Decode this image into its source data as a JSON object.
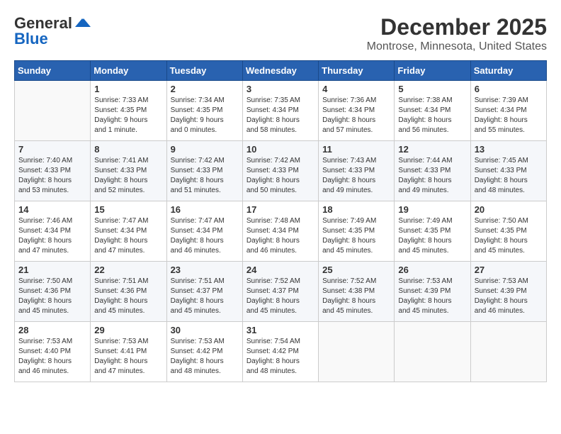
{
  "header": {
    "logo_line1": "General",
    "logo_line2": "Blue",
    "title": "December 2025",
    "subtitle": "Montrose, Minnesota, United States"
  },
  "days_of_week": [
    "Sunday",
    "Monday",
    "Tuesday",
    "Wednesday",
    "Thursday",
    "Friday",
    "Saturday"
  ],
  "weeks": [
    [
      {
        "day": "",
        "info": ""
      },
      {
        "day": "1",
        "info": "Sunrise: 7:33 AM\nSunset: 4:35 PM\nDaylight: 9 hours\nand 1 minute."
      },
      {
        "day": "2",
        "info": "Sunrise: 7:34 AM\nSunset: 4:35 PM\nDaylight: 9 hours\nand 0 minutes."
      },
      {
        "day": "3",
        "info": "Sunrise: 7:35 AM\nSunset: 4:34 PM\nDaylight: 8 hours\nand 58 minutes."
      },
      {
        "day": "4",
        "info": "Sunrise: 7:36 AM\nSunset: 4:34 PM\nDaylight: 8 hours\nand 57 minutes."
      },
      {
        "day": "5",
        "info": "Sunrise: 7:38 AM\nSunset: 4:34 PM\nDaylight: 8 hours\nand 56 minutes."
      },
      {
        "day": "6",
        "info": "Sunrise: 7:39 AM\nSunset: 4:34 PM\nDaylight: 8 hours\nand 55 minutes."
      }
    ],
    [
      {
        "day": "7",
        "info": "Sunrise: 7:40 AM\nSunset: 4:33 PM\nDaylight: 8 hours\nand 53 minutes."
      },
      {
        "day": "8",
        "info": "Sunrise: 7:41 AM\nSunset: 4:33 PM\nDaylight: 8 hours\nand 52 minutes."
      },
      {
        "day": "9",
        "info": "Sunrise: 7:42 AM\nSunset: 4:33 PM\nDaylight: 8 hours\nand 51 minutes."
      },
      {
        "day": "10",
        "info": "Sunrise: 7:42 AM\nSunset: 4:33 PM\nDaylight: 8 hours\nand 50 minutes."
      },
      {
        "day": "11",
        "info": "Sunrise: 7:43 AM\nSunset: 4:33 PM\nDaylight: 8 hours\nand 49 minutes."
      },
      {
        "day": "12",
        "info": "Sunrise: 7:44 AM\nSunset: 4:33 PM\nDaylight: 8 hours\nand 49 minutes."
      },
      {
        "day": "13",
        "info": "Sunrise: 7:45 AM\nSunset: 4:33 PM\nDaylight: 8 hours\nand 48 minutes."
      }
    ],
    [
      {
        "day": "14",
        "info": "Sunrise: 7:46 AM\nSunset: 4:34 PM\nDaylight: 8 hours\nand 47 minutes."
      },
      {
        "day": "15",
        "info": "Sunrise: 7:47 AM\nSunset: 4:34 PM\nDaylight: 8 hours\nand 47 minutes."
      },
      {
        "day": "16",
        "info": "Sunrise: 7:47 AM\nSunset: 4:34 PM\nDaylight: 8 hours\nand 46 minutes."
      },
      {
        "day": "17",
        "info": "Sunrise: 7:48 AM\nSunset: 4:34 PM\nDaylight: 8 hours\nand 46 minutes."
      },
      {
        "day": "18",
        "info": "Sunrise: 7:49 AM\nSunset: 4:35 PM\nDaylight: 8 hours\nand 45 minutes."
      },
      {
        "day": "19",
        "info": "Sunrise: 7:49 AM\nSunset: 4:35 PM\nDaylight: 8 hours\nand 45 minutes."
      },
      {
        "day": "20",
        "info": "Sunrise: 7:50 AM\nSunset: 4:35 PM\nDaylight: 8 hours\nand 45 minutes."
      }
    ],
    [
      {
        "day": "21",
        "info": "Sunrise: 7:50 AM\nSunset: 4:36 PM\nDaylight: 8 hours\nand 45 minutes."
      },
      {
        "day": "22",
        "info": "Sunrise: 7:51 AM\nSunset: 4:36 PM\nDaylight: 8 hours\nand 45 minutes."
      },
      {
        "day": "23",
        "info": "Sunrise: 7:51 AM\nSunset: 4:37 PM\nDaylight: 8 hours\nand 45 minutes."
      },
      {
        "day": "24",
        "info": "Sunrise: 7:52 AM\nSunset: 4:37 PM\nDaylight: 8 hours\nand 45 minutes."
      },
      {
        "day": "25",
        "info": "Sunrise: 7:52 AM\nSunset: 4:38 PM\nDaylight: 8 hours\nand 45 minutes."
      },
      {
        "day": "26",
        "info": "Sunrise: 7:53 AM\nSunset: 4:39 PM\nDaylight: 8 hours\nand 45 minutes."
      },
      {
        "day": "27",
        "info": "Sunrise: 7:53 AM\nSunset: 4:39 PM\nDaylight: 8 hours\nand 46 minutes."
      }
    ],
    [
      {
        "day": "28",
        "info": "Sunrise: 7:53 AM\nSunset: 4:40 PM\nDaylight: 8 hours\nand 46 minutes."
      },
      {
        "day": "29",
        "info": "Sunrise: 7:53 AM\nSunset: 4:41 PM\nDaylight: 8 hours\nand 47 minutes."
      },
      {
        "day": "30",
        "info": "Sunrise: 7:53 AM\nSunset: 4:42 PM\nDaylight: 8 hours\nand 48 minutes."
      },
      {
        "day": "31",
        "info": "Sunrise: 7:54 AM\nSunset: 4:42 PM\nDaylight: 8 hours\nand 48 minutes."
      },
      {
        "day": "",
        "info": ""
      },
      {
        "day": "",
        "info": ""
      },
      {
        "day": "",
        "info": ""
      }
    ]
  ]
}
